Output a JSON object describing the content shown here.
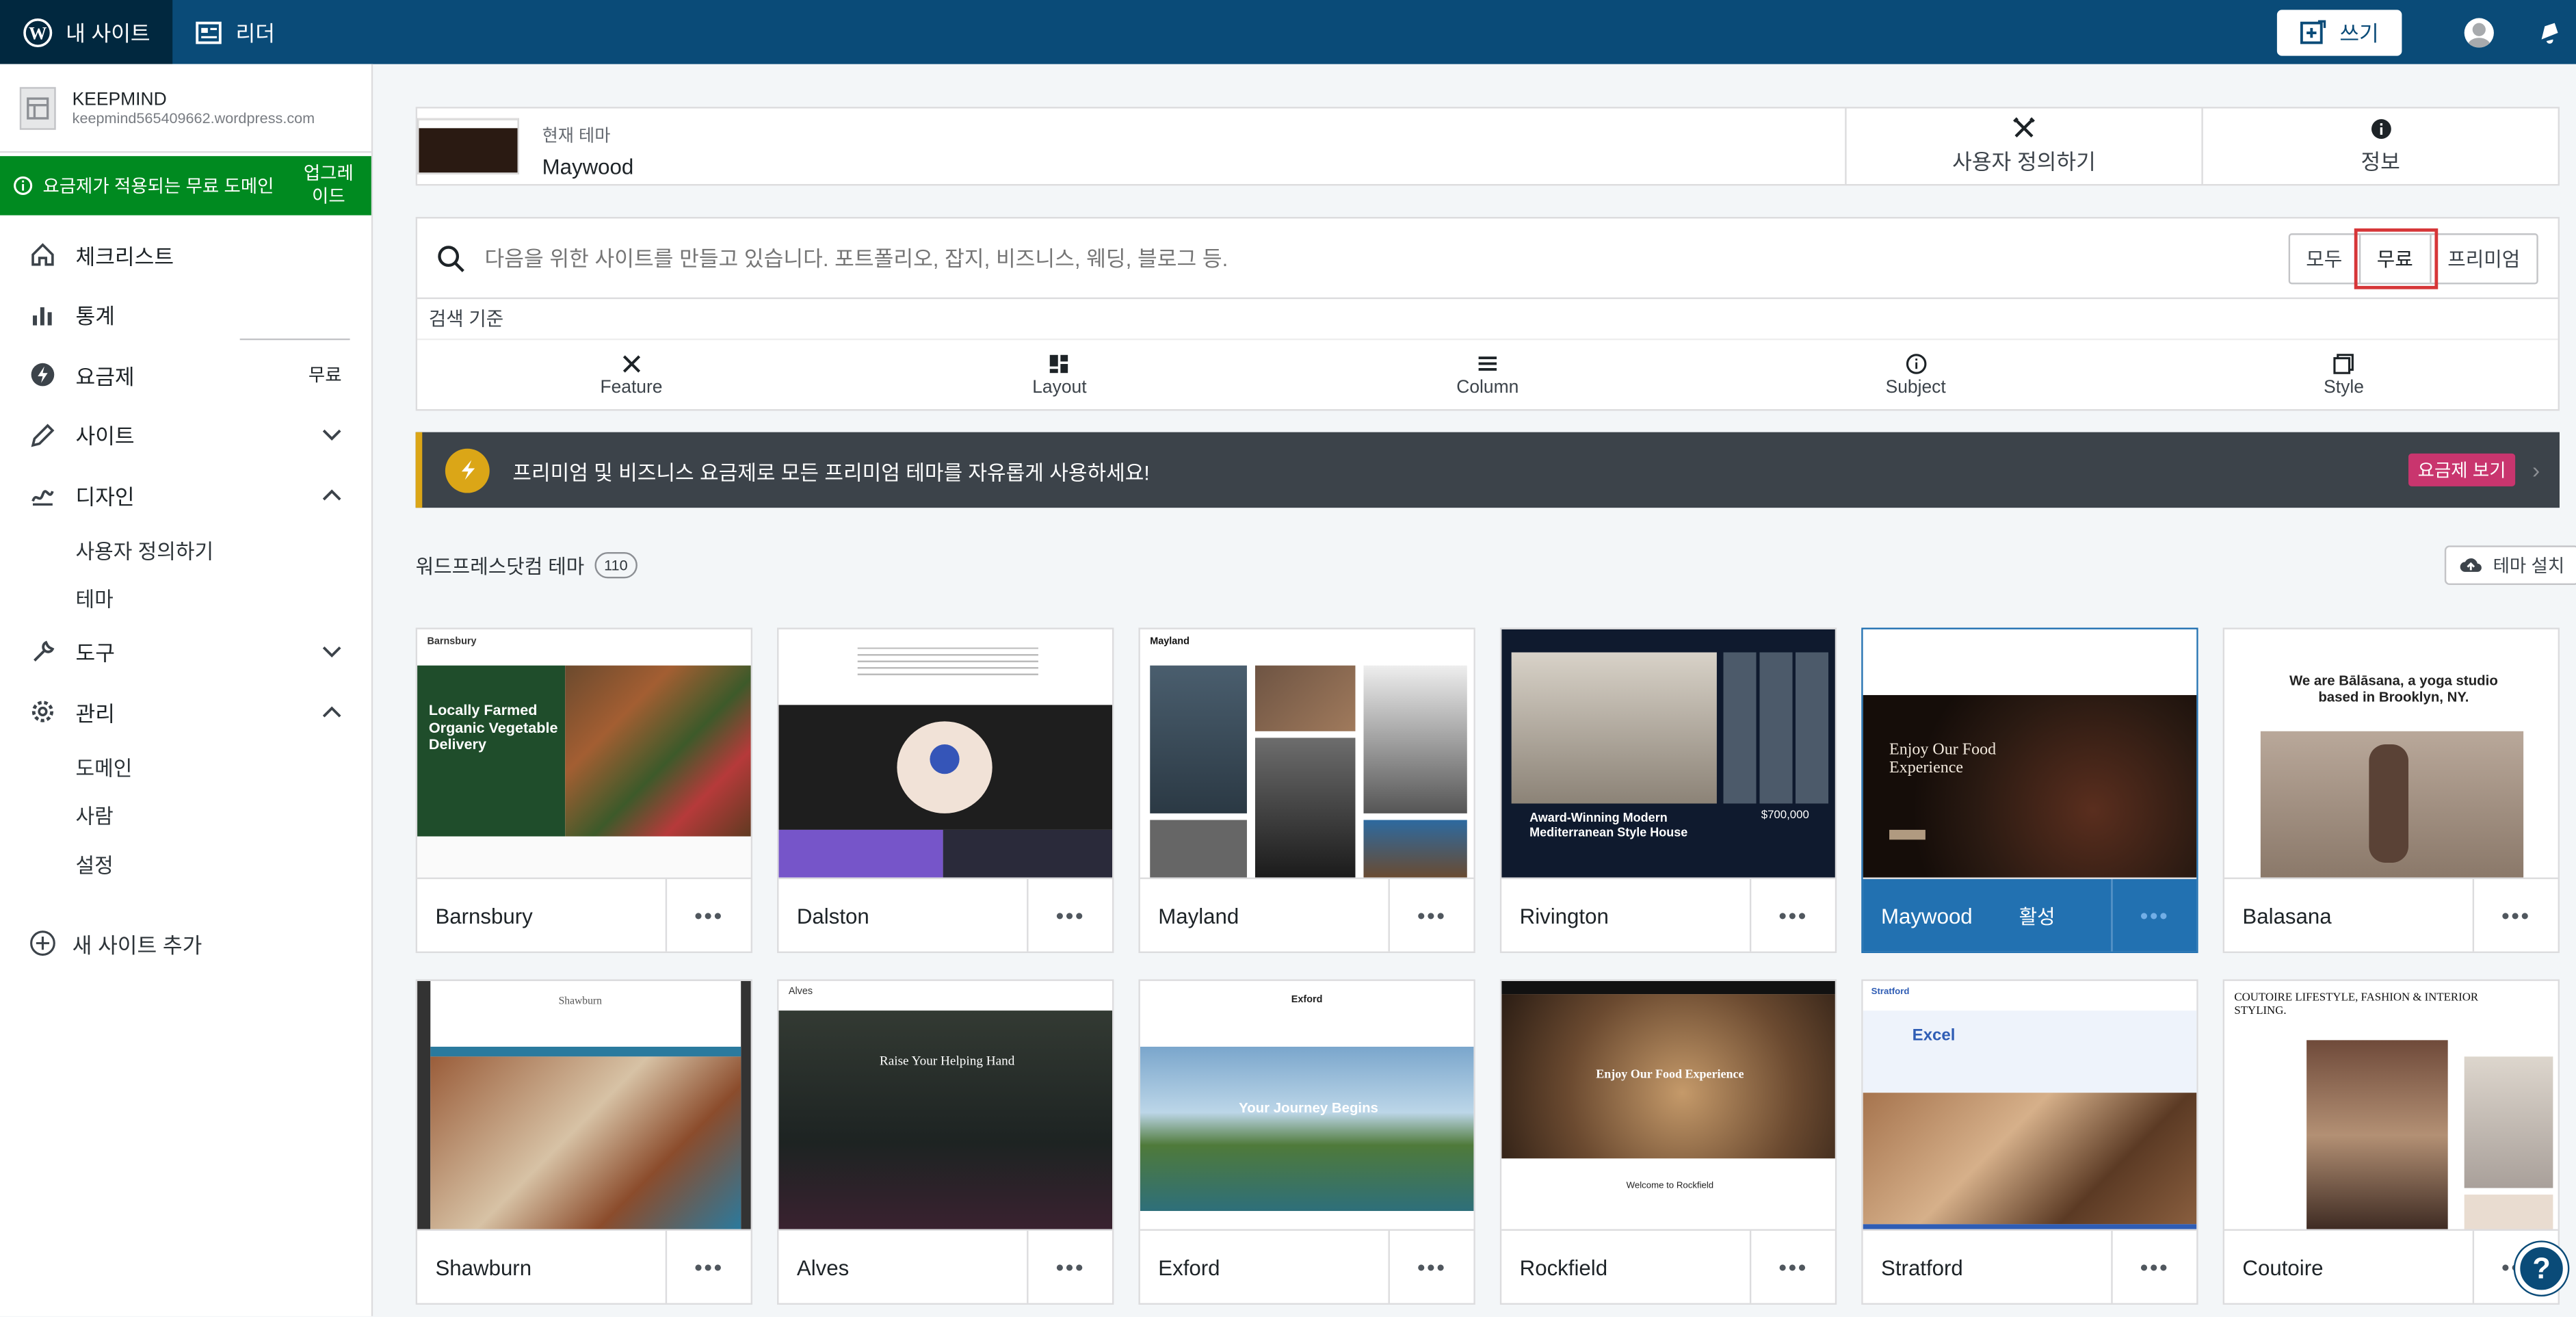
{
  "topbar": {
    "my_sites": "내 사이트",
    "reader": "리더",
    "write": "쓰기"
  },
  "sidebar": {
    "site_name": "KEEPMIND",
    "site_url": "keepmind565409662.wordpress.com",
    "upgrade_notice": "요금제가 적용되는 무료 도메인",
    "upgrade_action": "업그레이드",
    "items": [
      {
        "label": "체크리스트",
        "icon": "home-icon"
      },
      {
        "label": "통계",
        "icon": "stats-icon"
      },
      {
        "label": "요금제",
        "icon": "plan-icon",
        "badge": "무료"
      },
      {
        "label": "사이트",
        "icon": "pencil-icon"
      },
      {
        "label": "디자인",
        "icon": "design-icon"
      },
      {
        "label": "도구",
        "icon": "tools-icon"
      },
      {
        "label": "관리",
        "icon": "gear-icon"
      }
    ],
    "design_sub": [
      "사용자 정의하기",
      "테마"
    ],
    "manage_sub": [
      "도메인",
      "사람",
      "설정"
    ],
    "add_site": "새 사이트 추가"
  },
  "current_theme": {
    "label": "현재 테마",
    "name": "Maywood",
    "customize": "사용자 정의하기",
    "info": "정보"
  },
  "search": {
    "placeholder": "다음을 위한 사이트를 만들고 있습니다. 포트폴리오, 잡지, 비즈니스, 웨딩, 블로그 등.",
    "tiers": [
      "모두",
      "무료",
      "프리미엄"
    ],
    "selected_tier": "무료",
    "search_by": "검색 기준",
    "filters": [
      "Feature",
      "Layout",
      "Column",
      "Subject",
      "Style"
    ]
  },
  "promo": {
    "text": "프리미엄 및 비즈니스 요금제로 모든 프리미엄 테마를 자유롭게 사용하세요!",
    "button": "요금제 보기"
  },
  "themes_section": {
    "title": "워드프레스닷컴 테마",
    "count": "110",
    "install": "테마 설치",
    "active_label": "활성"
  },
  "themes": [
    {
      "name": "Barnsbury",
      "active": false
    },
    {
      "name": "Dalston",
      "active": false
    },
    {
      "name": "Mayland",
      "active": false
    },
    {
      "name": "Rivington",
      "active": false
    },
    {
      "name": "Maywood",
      "active": true
    },
    {
      "name": "Balasana",
      "active": false
    },
    {
      "name": "Shawburn",
      "active": false
    },
    {
      "name": "Alves",
      "active": false
    },
    {
      "name": "Exford",
      "active": false
    },
    {
      "name": "Rockfield",
      "active": false
    },
    {
      "name": "Stratford",
      "active": false
    },
    {
      "name": "Coutoire",
      "active": false
    }
  ],
  "previews": {
    "barnsbury": "Locally Farmed Organic Vegetable Delivery",
    "rivington_title": "Award-Winning Modern Mediterranean Style House",
    "rivington_price": "$700,000",
    "maywood": "Enjoy Our Food Experience",
    "balasana": "We are Bālāsana, a yoga studio based in Brooklyn, NY.",
    "alves": "Raise Your Helping Hand",
    "exford": "Your Journey Begins",
    "rockfield": "Enjoy Our Food Experience",
    "rockfield_welcome": "Welcome to Rockfield",
    "stratford": "Excel",
    "coutoire": "COUTOIRE LIFESTYLE, FASHION & INTERIOR STYLING."
  },
  "colors": {
    "topbar": "#0a4b78",
    "upgrade": "#008a20",
    "promo_accent": "#dba617",
    "promo_button": "#c9356e",
    "active_card": "#2271b1",
    "selected_outline": "#d63638"
  }
}
